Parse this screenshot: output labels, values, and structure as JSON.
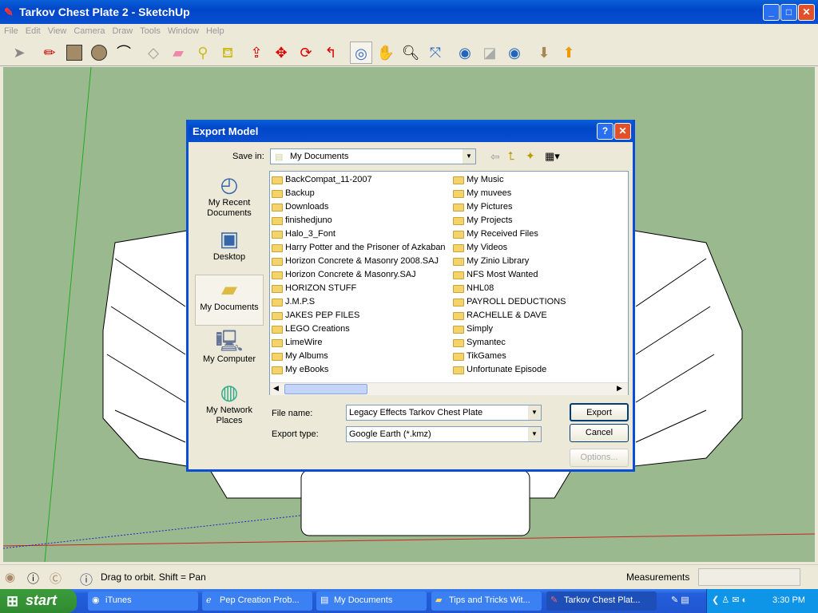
{
  "window": {
    "title": "Tarkov Chest Plate 2 - SketchUp"
  },
  "menu": [
    "File",
    "Edit",
    "View",
    "Camera",
    "Draw",
    "Tools",
    "Window",
    "Help"
  ],
  "toolbar": [
    "select",
    "pencil",
    "rectangle",
    "circle",
    "arc",
    "make-component",
    "eraser",
    "tape-measure",
    "paint-bucket",
    "push-pull",
    "move",
    "rotate",
    "follow-me",
    "orbit",
    "pan",
    "zoom",
    "zoom-extents",
    "get-current-view",
    "toggle-terrain",
    "place-model",
    "get-models",
    "share-model"
  ],
  "dialog": {
    "title": "Export Model",
    "save_in_label": "Save in:",
    "save_in_value": "My Documents",
    "places": [
      "My Recent Documents",
      "Desktop",
      "My Documents",
      "My Computer",
      "My Network Places"
    ],
    "files_col1": [
      "BackCompat_11-2007",
      "Backup",
      "Downloads",
      "finishedjuno",
      "Halo_3_Font",
      "Harry Potter and the Prisoner of Azkaban",
      "Horizon Concrete & Masonry 2008.SAJ",
      "Horizon Concrete & Masonry.SAJ",
      "HORIZON STUFF",
      "J.M.P.S",
      "JAKES PEP FILES",
      "LEGO Creations",
      "LimeWire",
      "My Albums",
      "My eBooks"
    ],
    "files_col2": [
      "My Music",
      "My muvees",
      "My Pictures",
      "My Projects",
      "My Received Files",
      "My Videos",
      "My Zinio Library",
      "NFS Most Wanted",
      "NHL08",
      "PAYROLL DEDUCTIONS",
      "RACHELLE & DAVE",
      "Simply",
      "Symantec",
      "TikGames",
      "Unfortunate Episode"
    ],
    "file_name_label": "File name:",
    "file_name_value": "Legacy Effects Tarkov Chest Plate",
    "export_type_label": "Export type:",
    "export_type_value": "Google Earth (*.kmz)",
    "export_button": "Export",
    "cancel_button": "Cancel",
    "options_button": "Options..."
  },
  "status": {
    "hint": "Drag to orbit.  Shift = Pan",
    "measurements_label": "Measurements",
    "measurements_value": ""
  },
  "taskbar": {
    "start": "start",
    "tasks": [
      "iTunes",
      "Pep Creation Prob...",
      "My Documents",
      "Tips and Tricks Wit...",
      "Tarkov Chest Plat..."
    ],
    "clock": "3:30 PM"
  }
}
